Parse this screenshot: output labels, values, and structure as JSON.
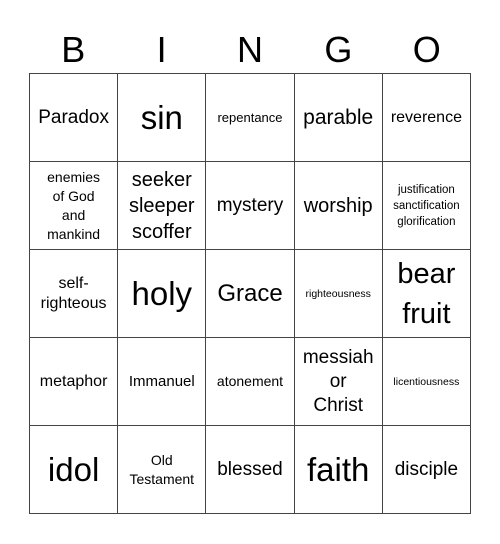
{
  "title_letters": [
    "B",
    "I",
    "N",
    "G",
    "O"
  ],
  "cells": [
    [
      "Paradox",
      "sin",
      "repentance",
      "parable",
      "reverence"
    ],
    [
      "enemies\nof God\nand\nmankind",
      "seeker\nsleeper\nscoffer",
      "mystery",
      "worship",
      "justification\nsanctification\nglorification"
    ],
    [
      "self-\nrighteous",
      "holy",
      "Grace",
      "righteousness",
      "bear\nfruit"
    ],
    [
      "metaphor",
      "Immanuel",
      "atonement",
      "messiah\nor\nChrist",
      "licentiousness"
    ],
    [
      "idol",
      "Old\nTestament",
      "blessed",
      "faith",
      "disciple"
    ]
  ]
}
